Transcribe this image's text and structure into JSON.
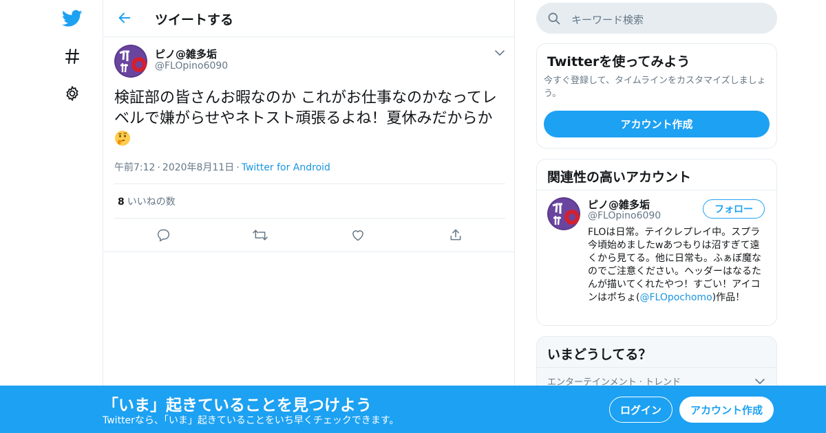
{
  "colors": {
    "accent": "#1da1f2",
    "link": "#1b95e0",
    "muted": "#657786",
    "border": "#e6ecf0",
    "text": "#14171a"
  },
  "nav": {
    "items": [
      {
        "icon": "twitter-bird-icon"
      },
      {
        "icon": "hashtag-icon"
      },
      {
        "icon": "gear-icon"
      }
    ]
  },
  "header": {
    "title": "ツイートする",
    "back_icon": "arrow-left-icon"
  },
  "tweet": {
    "display_name": "ピノ@雑多垢",
    "handle": "@FLOpino6090",
    "text": "検証部の皆さんお暇なのか これがお仕事なのかなってレベルで嫌がらせやネトスト頑張るよね！夏休みだからか",
    "emoji": "thinking-face-icon",
    "time": "午前7:12",
    "date": "2020年8月11日",
    "source": "Twitter for Android",
    "separator": "·",
    "likes_count": "8",
    "likes_label": "いいねの数",
    "actions": [
      "reply-icon",
      "retweet-icon",
      "like-icon",
      "share-icon"
    ]
  },
  "search": {
    "placeholder": "キーワード検索"
  },
  "signup_card": {
    "title": "Twitterを使ってみよう",
    "description": "今すぐ登録して、タイムラインをカスタマイズしましょう。",
    "button": "アカウント作成"
  },
  "related_card": {
    "title": "関連性の高いアカウント",
    "display_name": "ピノ@雑多垢",
    "handle": "@FLOpino6090",
    "follow_label": "フォロー",
    "bio_before": "FLOは日常。テイクレプレイ中。スプラ今頃始めましたwあつもりは沼すぎて遠くから見てる。他に日常も。ふぁぼ魔なのでご注意ください。ヘッダーはなるたんが描いてくれたやつ！すごい！アイコンはポちょ(",
    "bio_mention": "@FLOpochomo",
    "bio_after": ")作品！"
  },
  "trends_card": {
    "title": "いまどうしてる？",
    "category": "エンターテインメント · トレンド"
  },
  "banner": {
    "title": "「いま」起きていることを見つけよう",
    "subtitle": "Twitterなら、「いま」起きていることをいち早くチェックできます。",
    "login_label": "ログイン",
    "signup_label": "アカウント作成"
  }
}
